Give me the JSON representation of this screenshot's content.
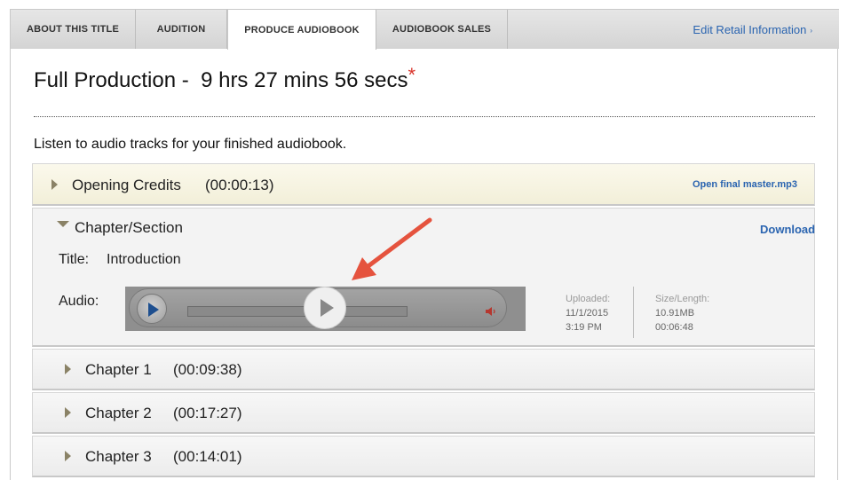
{
  "tabs": [
    {
      "label": "ABOUT THIS TITLE"
    },
    {
      "label": "AUDITION"
    },
    {
      "label": "PRODUCE AUDIOBOOK",
      "active": true
    },
    {
      "label": "AUDIOBOOK SALES"
    }
  ],
  "retail_link": {
    "label": "Edit Retail Information",
    "caret": "›"
  },
  "header": {
    "title": "Full Production -  9 hrs 27 mins 56 secs",
    "asterisk": "*",
    "intro": "Listen to audio tracks for your finished audiobook."
  },
  "tracks": {
    "credits": {
      "label": "Opening Credits",
      "duration": "(00:00:13)",
      "link": "Open final master.mp3"
    },
    "section": {
      "label": "Chapter/Section",
      "download": "Download",
      "title_label": "Title:",
      "title_value": "Introduction",
      "audio_label": "Audio:",
      "uploaded_label": "Uploaded:",
      "uploaded_date": "11/1/2015",
      "uploaded_time": "3:19 PM",
      "size_label": "Size/Length:",
      "size_value": "10.91MB",
      "length_value": "00:06:48"
    },
    "chapters": [
      {
        "label": "Chapter 1",
        "duration": "(00:09:38)"
      },
      {
        "label": "Chapter 2",
        "duration": "(00:17:27)"
      },
      {
        "label": "Chapter 3",
        "duration": "(00:14:01)"
      }
    ]
  },
  "colors": {
    "link": "#2a64b0",
    "asterisk": "#d9342b",
    "arrow": "#e5533e",
    "credits_bg": "#f2efd9"
  },
  "icons": [
    "play-icon",
    "volume-icon",
    "expand-triangle-icon",
    "collapse-triangle-icon",
    "annotation-arrow-icon"
  ]
}
